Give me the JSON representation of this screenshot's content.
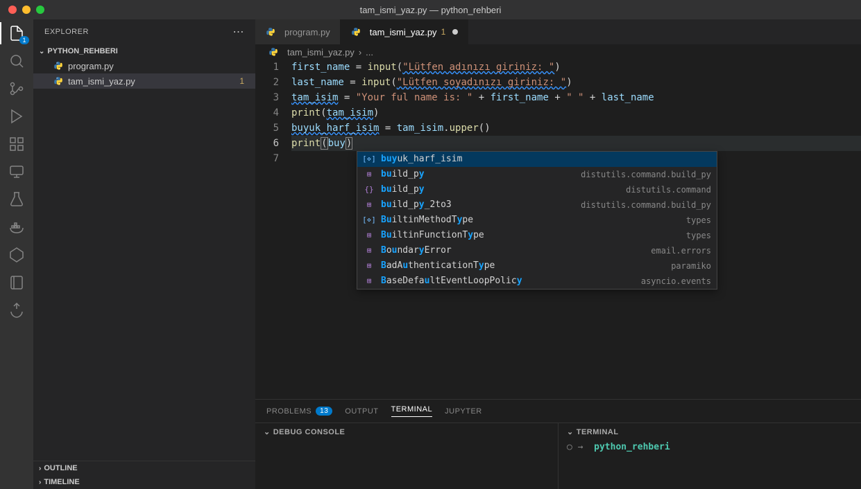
{
  "titlebar": {
    "title": "tam_ismi_yaz.py — python_rehberi"
  },
  "activitybar": {
    "explorer_badge": "1"
  },
  "sidebar": {
    "header": "EXPLORER",
    "project": "PYTHON_REHBERI",
    "files": [
      {
        "name": "program.py",
        "badge": ""
      },
      {
        "name": "tam_ismi_yaz.py",
        "badge": "1"
      }
    ],
    "outline": "OUTLINE",
    "timeline": "TIMELINE"
  },
  "tabs": [
    {
      "name": "program.py",
      "badge": "",
      "active": false
    },
    {
      "name": "tam_ismi_yaz.py",
      "badge": "1",
      "active": true,
      "dirty": true
    }
  ],
  "breadcrumb": {
    "file": "tam_ismi_yaz.py",
    "rest": "..."
  },
  "code": {
    "lines": [
      "1",
      "2",
      "3",
      "4",
      "5",
      "6",
      "7"
    ],
    "l1_var": "first_name",
    "l1_op": " = ",
    "l1_fn": "input",
    "l1_par1": "(",
    "l1_str": "\"Lütfen adınızı giriniz: \"",
    "l1_par2": ")",
    "l2_var": "last_name",
    "l2_op": " = ",
    "l2_fn": "input",
    "l2_par1": "(",
    "l2_str": "\"Lütfen soyadınızı giriniz: \"",
    "l2_par2": ")",
    "l3_var": "tam_isim",
    "l3_op": " = ",
    "l3_str1": "\"Your ful name is: \"",
    "l3_op2": " + ",
    "l3_var2": "first_name",
    "l3_op3": " + ",
    "l3_str2": "\" \"",
    "l3_op4": " + ",
    "l3_var3": "last_name",
    "l4_fn": "print",
    "l4_par1": "(",
    "l4_var": "tam_isim",
    "l4_par2": ")",
    "l5_var": "buyuk_harf_isim",
    "l5_op": " = ",
    "l5_var2": "tam_isim",
    "l5_dot": ".",
    "l5_fn": "upper",
    "l5_par": "()",
    "l6_fn": "print",
    "l6_par1": "(",
    "l6_var": "buy",
    "l6_par2": ")"
  },
  "intellisense": [
    {
      "kind": "var",
      "bold": "buy",
      "rest": "uk_harf_isim",
      "detail": ""
    },
    {
      "kind": "meth",
      "bold": "bu",
      "rest": "ild_p",
      "bold2": "y",
      "detail": "distutils.command.build_py"
    },
    {
      "kind": "ns",
      "bold": "bu",
      "rest": "ild_p",
      "bold2": "y",
      "detail": "distutils.command"
    },
    {
      "kind": "meth",
      "bold": "bu",
      "rest": "ild_p",
      "bold2": "y",
      "rest2": "_2to3",
      "detail": "distutils.command.build_py"
    },
    {
      "kind": "var",
      "bold": "Bu",
      "rest": "iltinMethodT",
      "bold2": "y",
      "rest2": "pe",
      "detail": "types"
    },
    {
      "kind": "meth",
      "bold": "Bu",
      "rest": "iltinFunctionT",
      "bold2": "y",
      "rest2": "pe",
      "detail": "types"
    },
    {
      "kind": "meth",
      "bold": "B",
      "rest": "o",
      "bold2": "u",
      "rest2": "ndar",
      "bold3": "y",
      "rest3": "Error",
      "detail": "email.errors"
    },
    {
      "kind": "meth",
      "bold": "B",
      "rest": "adA",
      "bold2": "u",
      "rest2": "thenticationT",
      "bold3": "y",
      "rest3": "pe",
      "detail": "paramiko"
    },
    {
      "kind": "meth",
      "bold": "B",
      "rest": "aseDefa",
      "bold2": "u",
      "rest2": "ltEventLoopPolic",
      "bold3": "y",
      "detail": "asyncio.events"
    }
  ],
  "panel": {
    "tabs": {
      "problems": "PROBLEMS",
      "problems_badge": "13",
      "output": "OUTPUT",
      "terminal": "TERMINAL",
      "jupyter": "JUPYTER"
    },
    "debug_console": "DEBUG CONSOLE",
    "terminal_hdr": "TERMINAL",
    "prompt_sym": "○ →",
    "cwd": "python_rehberi"
  }
}
